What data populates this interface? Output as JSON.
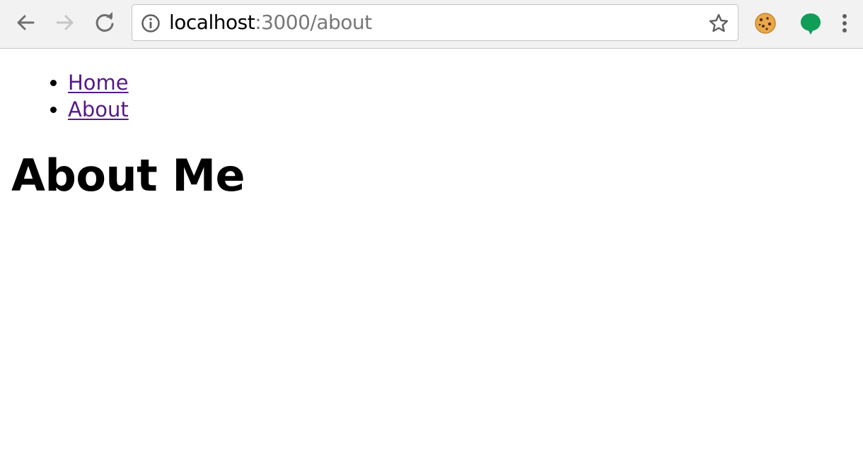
{
  "browser": {
    "address_bar": {
      "host": "localhost",
      "rest": ":3000/about"
    },
    "icons": {
      "back": "arrow-left-icon",
      "forward": "arrow-right-icon",
      "reload": "reload-icon",
      "info": "info-icon",
      "bookmark": "star-icon",
      "extension_1": "cookie-icon",
      "extension_2": "speech-bubble-icon",
      "menu": "kebab-menu-icon"
    },
    "colors": {
      "toolbar_bg": "#f2f2f2",
      "url_host": "#000000",
      "url_rest": "#777777",
      "extension_green": "#0f9d58"
    }
  },
  "page": {
    "nav": [
      {
        "label": "Home"
      },
      {
        "label": "About"
      }
    ],
    "title": "About Me",
    "colors": {
      "link_visited": "#551a8b",
      "text": "#000000"
    }
  }
}
